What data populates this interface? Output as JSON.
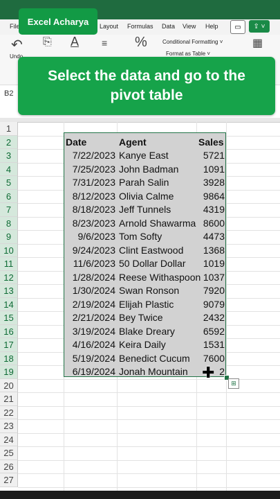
{
  "brand": "Excel Acharya",
  "menu": {
    "file": "File",
    "layout": "Layout",
    "formulas": "Formulas",
    "data": "Data",
    "view": "View",
    "help": "Help"
  },
  "ribbon": {
    "undo": "Undo",
    "percent_symbol": "%",
    "conditional_formatting": "Conditional Formatting ˅",
    "format_as_table": "Format as Table ˅"
  },
  "banner": {
    "text": "Select the data and go to the pivot table"
  },
  "name_box": "B2",
  "table": {
    "headers": [
      "Date",
      "Agent",
      "Sales"
    ],
    "rows": [
      [
        "7/22/2023",
        "Kanye East",
        "5721"
      ],
      [
        "7/25/2023",
        "John Badman",
        "1091"
      ],
      [
        "7/31/2023",
        "Parah Salin",
        "3928"
      ],
      [
        "8/12/2023",
        "Olivia Calme",
        "9864"
      ],
      [
        "8/18/2023",
        "Jeff Tunnels",
        "4319"
      ],
      [
        "8/23/2023",
        "Arnold Shawarma",
        "8600"
      ],
      [
        "9/6/2023",
        "Tom Softy",
        "4473"
      ],
      [
        "9/24/2023",
        "Clint Eastwood",
        "1368"
      ],
      [
        "11/6/2023",
        "50 Dollar Dollar",
        "1019"
      ],
      [
        "1/28/2024",
        "Reese Withaspoon",
        "1037"
      ],
      [
        "1/30/2024",
        "Swan Ronson",
        "7920"
      ],
      [
        "2/19/2024",
        "Elijah Plastic",
        "9079"
      ],
      [
        "2/21/2024",
        "Bey Twice",
        "2432"
      ],
      [
        "3/19/2024",
        "Blake Dreary",
        "6592"
      ],
      [
        "4/16/2024",
        "Keira Daily",
        "1531"
      ],
      [
        "5/19/2024",
        "Benedict Cucum",
        "7600"
      ],
      [
        "6/19/2024",
        "Jonah Mountain",
        "2"
      ]
    ]
  },
  "row_numbers": [
    "1",
    "2",
    "3",
    "4",
    "5",
    "6",
    "7",
    "8",
    "9",
    "10",
    "11",
    "12",
    "13",
    "14",
    "15",
    "16",
    "17",
    "18",
    "19",
    "20",
    "21",
    "22",
    "23",
    "24",
    "25",
    "26",
    "27"
  ],
  "colors": {
    "accent": "#16a34a",
    "excel_green": "#217346",
    "selection": "#d2d2d2"
  }
}
